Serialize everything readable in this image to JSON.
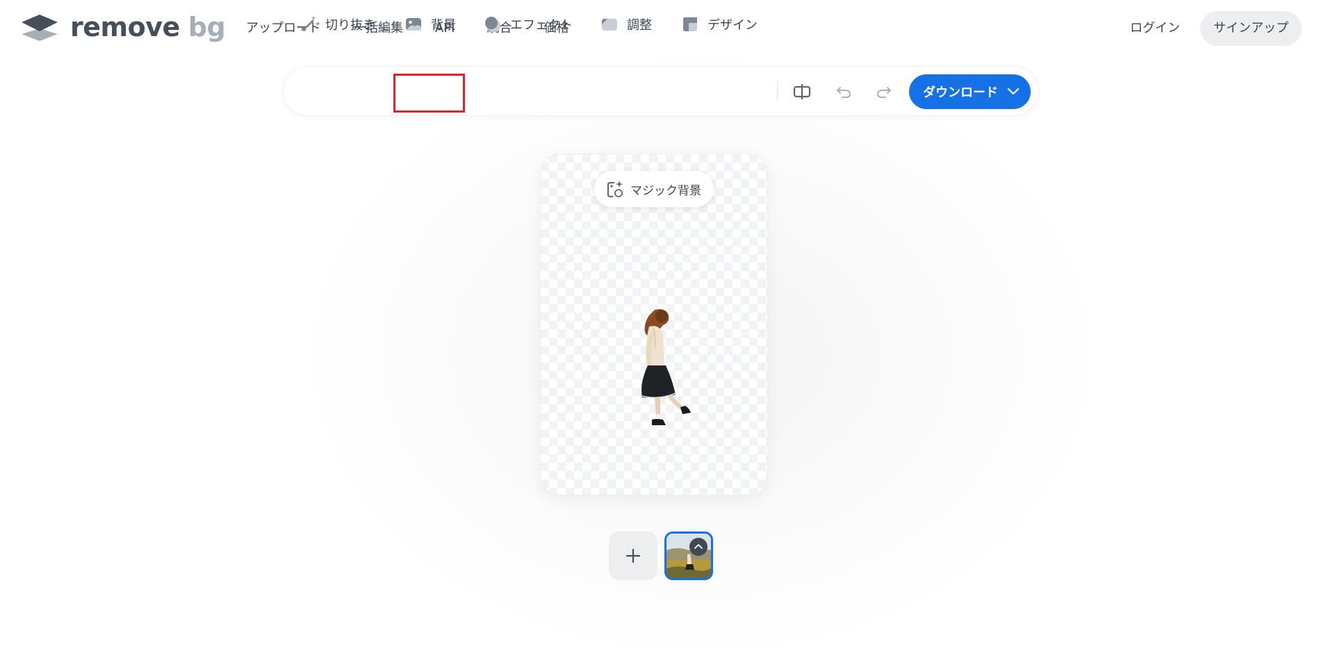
{
  "header": {
    "logo": {
      "remove": "remove",
      "bg": "bg"
    },
    "nav": [
      "アップロード",
      "一括編集",
      "API",
      "統合",
      "価格"
    ],
    "login": "ログイン",
    "signup": "サインアップ"
  },
  "toolbar": {
    "tools": [
      {
        "label": "切り抜き",
        "icon": "brush-icon"
      },
      {
        "label": "背景",
        "icon": "image-icon",
        "highlighted": true
      },
      {
        "label": "エフェクト",
        "icon": "effects-icon"
      },
      {
        "label": "調整",
        "icon": "adjust-icon"
      },
      {
        "label": "デザイン",
        "icon": "design-icon"
      }
    ],
    "compare_icon": "compare-icon",
    "undo_icon": "undo-icon",
    "redo_icon": "redo-icon",
    "download_label": "ダウンロード"
  },
  "canvas": {
    "magic_label": "マジック背景"
  },
  "colors": {
    "accent": "#1670e6",
    "highlight_border": "#e0212a",
    "text": "#3b4450"
  }
}
